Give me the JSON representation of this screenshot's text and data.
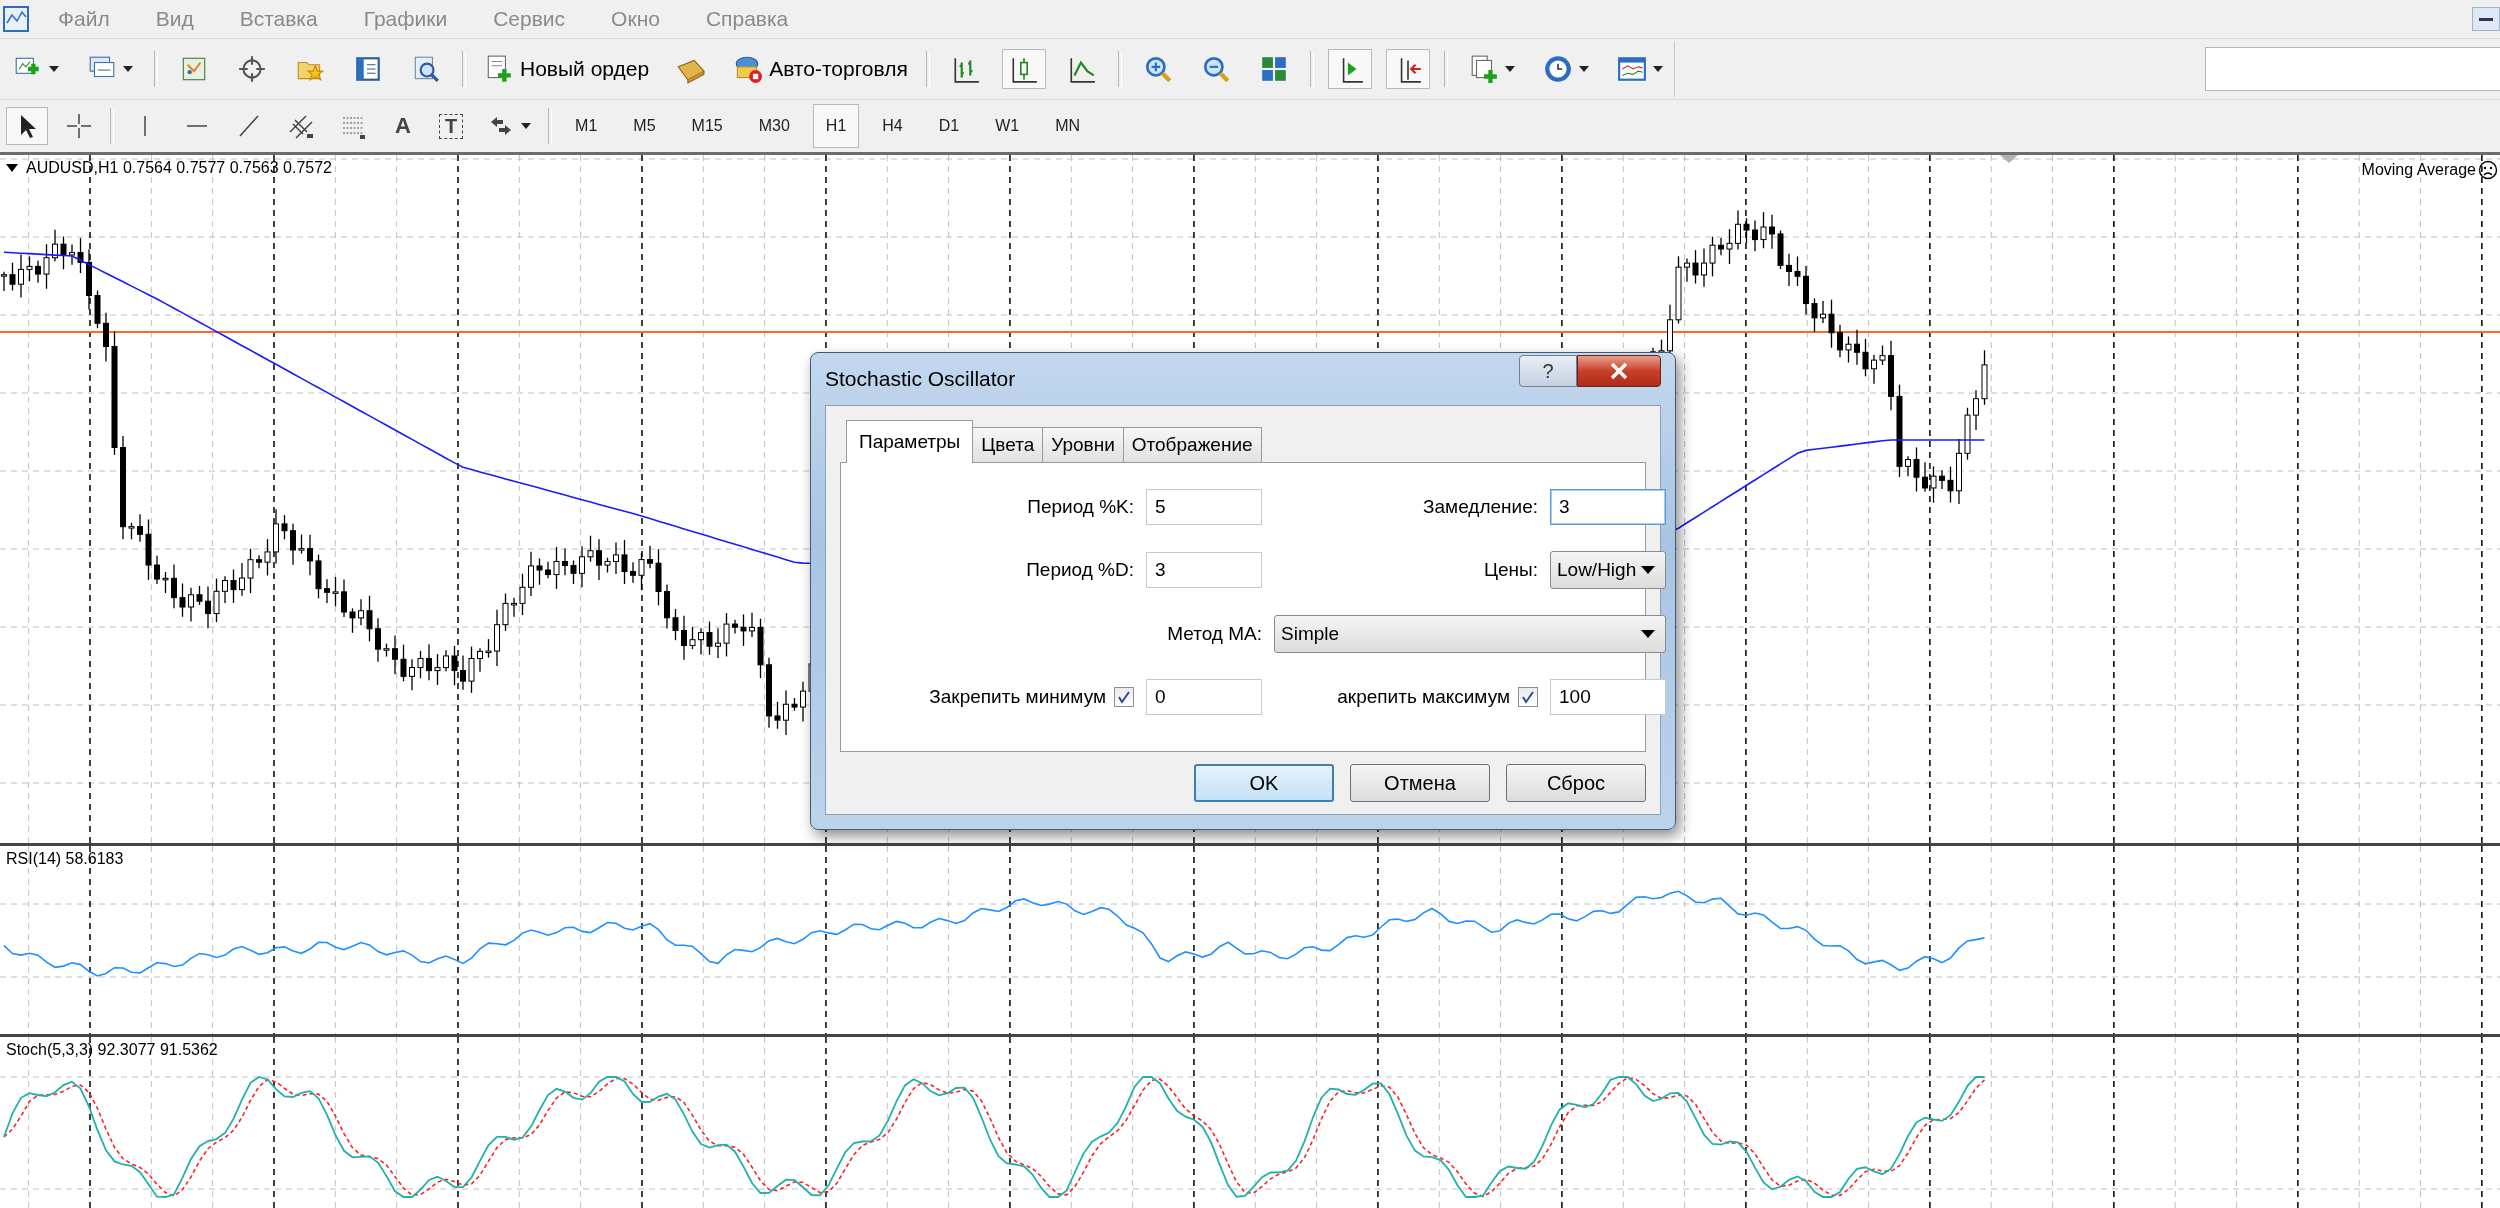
{
  "menu": [
    "Файл",
    "Вид",
    "Вставка",
    "Графики",
    "Сервис",
    "Окно",
    "Справка"
  ],
  "toolbar": {
    "new_order": "Новый ордер",
    "auto_trading": "Авто-торговля",
    "chart_modes": [
      {
        "selected": false
      },
      {
        "selected": true
      },
      {
        "selected": false
      }
    ],
    "scroll_toggles": [
      {
        "selected": true
      },
      {
        "selected": true
      }
    ]
  },
  "drawing_tools": {
    "pointers": [
      {
        "selected": true
      },
      {
        "selected": false
      }
    ],
    "text_tool": "A",
    "label_tool": "T"
  },
  "timeframes": [
    {
      "label": "M1",
      "selected": false
    },
    {
      "label": "M5",
      "selected": false
    },
    {
      "label": "M15",
      "selected": false
    },
    {
      "label": "M30",
      "selected": false
    },
    {
      "label": "H1",
      "selected": true
    },
    {
      "label": "H4",
      "selected": false
    },
    {
      "label": "D1",
      "selected": false
    },
    {
      "label": "W1",
      "selected": false
    },
    {
      "label": "MN",
      "selected": false
    }
  ],
  "chart": {
    "symbol_label": "AUDUSD,H1  0.7564 0.7577 0.7563 0.7572",
    "indicator_label": "Moving Average"
  },
  "rsi": {
    "label": "RSI(14) 58.6183"
  },
  "stoch": {
    "label": "Stoch(5,3,3) 92.3077 91.5362"
  },
  "dialog": {
    "title": "Stochastic Oscillator",
    "help": "?",
    "tabs": [
      {
        "label": "Параметры",
        "selected": true
      },
      {
        "label": "Цвета",
        "selected": false
      },
      {
        "label": "Уровни",
        "selected": false
      },
      {
        "label": "Отображение",
        "selected": false
      }
    ],
    "period_k": {
      "label": "Период %K:",
      "value": "5"
    },
    "slowing": {
      "label": "Замедление:",
      "value": "3",
      "focused": true
    },
    "period_d": {
      "label": "Период %D:",
      "value": "3"
    },
    "price_field": {
      "label": "Цены:",
      "value": "Low/High"
    },
    "ma_method": {
      "label": "Метод MA:",
      "value": "Simple"
    },
    "fix_min": {
      "label": "Закрепить минимум",
      "checked": true,
      "value": "0"
    },
    "fix_max": {
      "label": "акрепить максимум",
      "checked": true,
      "value": "100"
    },
    "buttons": [
      {
        "label": "OK",
        "default": true
      },
      {
        "label": "Отмена",
        "default": false
      },
      {
        "label": "Сброс",
        "default": false
      }
    ]
  }
}
